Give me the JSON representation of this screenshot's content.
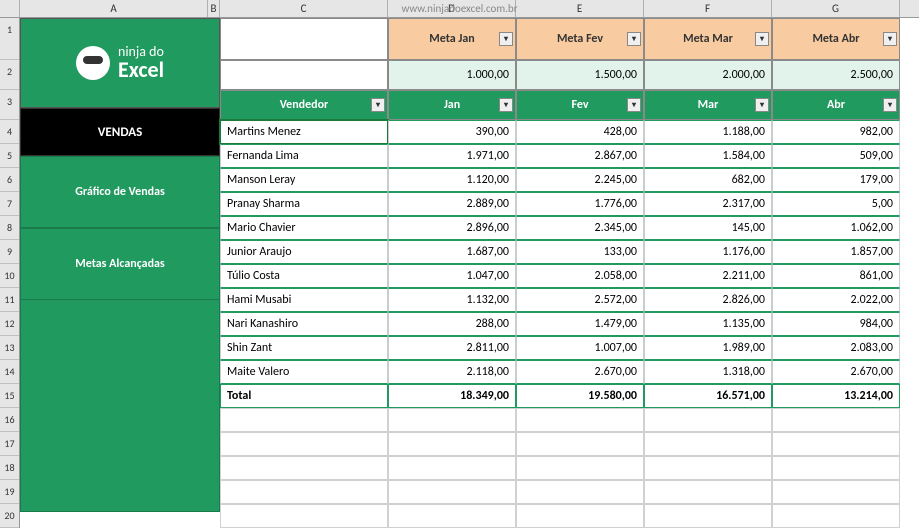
{
  "watermark": "www.ninjadoexcel.com.br",
  "columns": [
    "A",
    "B",
    "C",
    "D",
    "E",
    "F",
    "G"
  ],
  "rows": [
    "1",
    "2",
    "3",
    "4",
    "5",
    "6",
    "7",
    "8",
    "9",
    "10",
    "11",
    "12",
    "13",
    "14",
    "15",
    "16",
    "17",
    "18",
    "19",
    "20"
  ],
  "logo": {
    "line1": "ninja do",
    "line2": "Excel"
  },
  "sidebar": {
    "items": [
      {
        "label": "VENDAS"
      },
      {
        "label": "Gráfico de Vendas"
      },
      {
        "label": "Metas Alcançadas"
      }
    ]
  },
  "meta_headers": [
    "Meta Jan",
    "Meta Fev",
    "Meta Mar",
    "Meta Abr"
  ],
  "meta_values": [
    "1.000,00",
    "1.500,00",
    "2.000,00",
    "2.500,00"
  ],
  "table_headers": [
    "Vendedor",
    "Jan",
    "Fev",
    "Mar",
    "Abr"
  ],
  "vendors": [
    {
      "name": "Martins Menez",
      "vals": [
        "390,00",
        "428,00",
        "1.188,00",
        "982,00"
      ]
    },
    {
      "name": "Fernanda Lima",
      "vals": [
        "1.971,00",
        "2.867,00",
        "1.584,00",
        "509,00"
      ]
    },
    {
      "name": "Manson Leray",
      "vals": [
        "1.120,00",
        "2.245,00",
        "682,00",
        "179,00"
      ]
    },
    {
      "name": "Pranay Sharma",
      "vals": [
        "2.889,00",
        "1.776,00",
        "2.317,00",
        "5,00"
      ]
    },
    {
      "name": "Mario Chavier",
      "vals": [
        "2.896,00",
        "2.345,00",
        "145,00",
        "1.062,00"
      ]
    },
    {
      "name": "Junior Araujo",
      "vals": [
        "1.687,00",
        "133,00",
        "1.176,00",
        "1.857,00"
      ]
    },
    {
      "name": "Túlio Costa",
      "vals": [
        "1.047,00",
        "2.058,00",
        "2.211,00",
        "861,00"
      ]
    },
    {
      "name": "Hami Musabi",
      "vals": [
        "1.132,00",
        "2.572,00",
        "2.826,00",
        "2.022,00"
      ]
    },
    {
      "name": "Nari Kanashiro",
      "vals": [
        "288,00",
        "1.479,00",
        "1.135,00",
        "984,00"
      ]
    },
    {
      "name": "Shin Zant",
      "vals": [
        "2.811,00",
        "1.007,00",
        "1.989,00",
        "2.083,00"
      ]
    },
    {
      "name": "Maite Valero",
      "vals": [
        "2.118,00",
        "2.670,00",
        "1.318,00",
        "2.670,00"
      ]
    }
  ],
  "total": {
    "label": "Total",
    "vals": [
      "18.349,00",
      "19.580,00",
      "16.571,00",
      "13.214,00"
    ]
  }
}
